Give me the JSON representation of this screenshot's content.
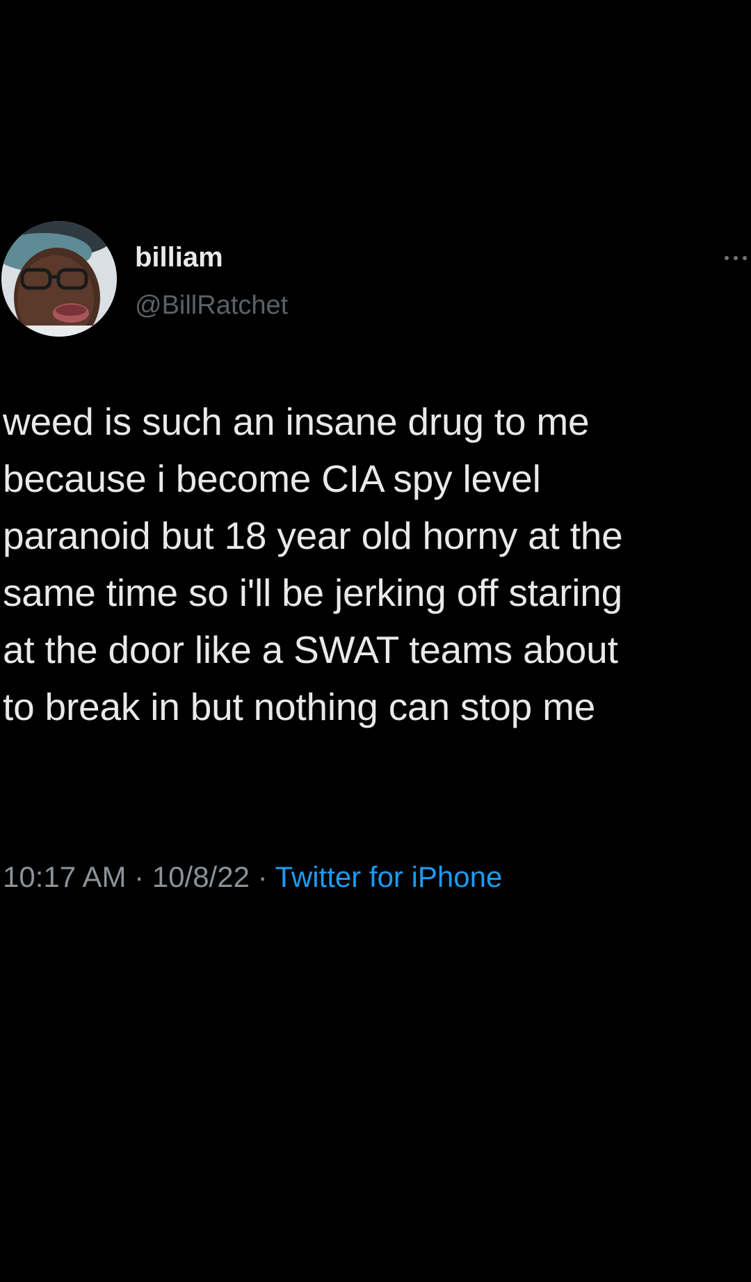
{
  "user": {
    "display_name": "billiam",
    "handle": "@BillRatchet",
    "avatar_icon": "profile-photo"
  },
  "tweet": {
    "lines": [
      "weed is such an insane drug to me",
      "because i become CIA spy level",
      "paranoid but 18 year old horny at the",
      "same time so i'll be jerking off staring",
      "at the door like a SWAT teams about",
      "to break in but nothing can stop me"
    ]
  },
  "meta": {
    "time": "10:17 AM",
    "separator": "·",
    "date": "10/8/22",
    "source": "Twitter for iPhone"
  },
  "menu": {
    "icon": "more-icon"
  },
  "colors": {
    "background": "#000000",
    "text": "#e7e9ea",
    "muted": "#5b6166",
    "meta": "#8b9298",
    "link": "#1d9bf0"
  }
}
